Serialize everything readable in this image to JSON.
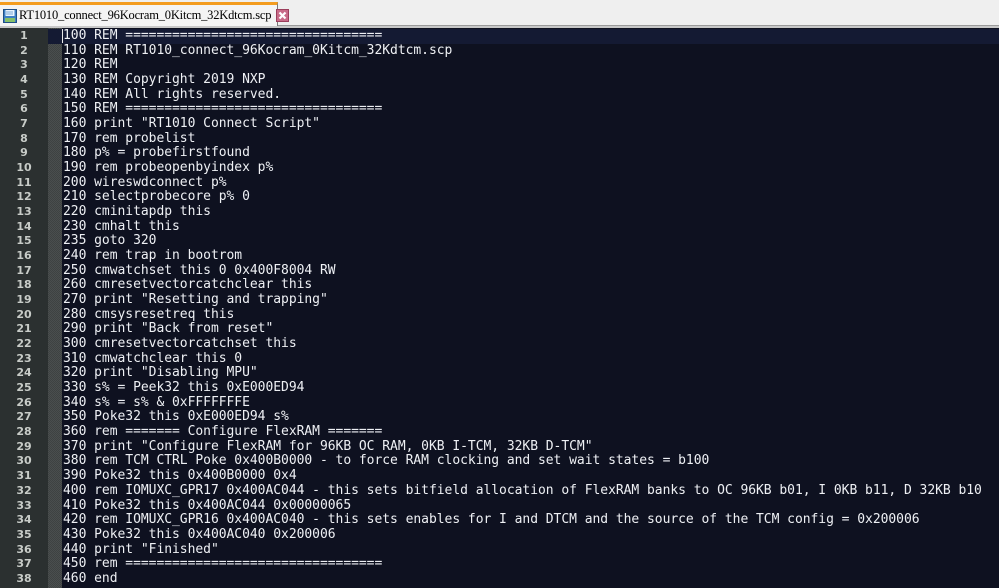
{
  "tab": {
    "title": "RT1010_connect_96Kocram_0Kitcm_32Kdtcm.scp",
    "icon": "save-icon",
    "close_icon": "close-icon"
  },
  "editor": {
    "current_line": 1,
    "lines": [
      {
        "num": "1",
        "text": "100 REM ================================="
      },
      {
        "num": "2",
        "text": "110 REM RT1010_connect_96Kocram_0Kitcm_32Kdtcm.scp"
      },
      {
        "num": "3",
        "text": "120 REM"
      },
      {
        "num": "4",
        "text": "130 REM Copyright 2019 NXP"
      },
      {
        "num": "5",
        "text": "140 REM All rights reserved."
      },
      {
        "num": "6",
        "text": "150 REM ================================="
      },
      {
        "num": "7",
        "text": "160 print \"RT1010 Connect Script\""
      },
      {
        "num": "8",
        "text": "170 rem probelist"
      },
      {
        "num": "9",
        "text": "180 p% = probefirstfound"
      },
      {
        "num": "10",
        "text": "190 rem probeopenbyindex p%"
      },
      {
        "num": "11",
        "text": "200 wireswdconnect p%"
      },
      {
        "num": "12",
        "text": "210 selectprobecore p% 0"
      },
      {
        "num": "13",
        "text": "220 cminitapdp this"
      },
      {
        "num": "14",
        "text": "230 cmhalt this"
      },
      {
        "num": "15",
        "text": "235 goto 320"
      },
      {
        "num": "16",
        "text": "240 rem trap in bootrom"
      },
      {
        "num": "17",
        "text": "250 cmwatchset this 0 0x400F8004 RW"
      },
      {
        "num": "18",
        "text": "260 cmresetvectorcatchclear this"
      },
      {
        "num": "19",
        "text": "270 print \"Resetting and trapping\""
      },
      {
        "num": "20",
        "text": "280 cmsysresetreq this"
      },
      {
        "num": "21",
        "text": "290 print \"Back from reset\""
      },
      {
        "num": "22",
        "text": "300 cmresetvectorcatchset this"
      },
      {
        "num": "23",
        "text": "310 cmwatchclear this 0"
      },
      {
        "num": "24",
        "text": "320 print \"Disabling MPU\""
      },
      {
        "num": "25",
        "text": "330 s% = Peek32 this 0xE000ED94"
      },
      {
        "num": "26",
        "text": "340 s% = s% & 0xFFFFFFFE"
      },
      {
        "num": "27",
        "text": "350 Poke32 this 0xE000ED94 s%"
      },
      {
        "num": "28",
        "text": "360 rem ======= Configure FlexRAM ======="
      },
      {
        "num": "29",
        "text": "370 print \"Configure FlexRAM for 96KB OC RAM, 0KB I-TCM, 32KB D-TCM\""
      },
      {
        "num": "30",
        "text": "380 rem TCM CTRL Poke 0x400B0000 - to force RAM clocking and set wait states = b100"
      },
      {
        "num": "31",
        "text": "390 Poke32 this 0x400B0000 0x4"
      },
      {
        "num": "32",
        "text": "400 rem IOMUXC_GPR17 0x400AC044 - this sets bitfield allocation of FlexRAM banks to OC 96KB b01, I 0KB b11, D 32KB b10"
      },
      {
        "num": "33",
        "text": "410 Poke32 this 0x400AC044 0x00000065"
      },
      {
        "num": "34",
        "text": "420 rem IOMUXC_GPR16 0x400AC040 - this sets enables for I and DTCM and the source of the TCM config = 0x200006"
      },
      {
        "num": "35",
        "text": "430 Poke32 this 0x400AC040 0x200006"
      },
      {
        "num": "36",
        "text": "440 print \"Finished\""
      },
      {
        "num": "37",
        "text": "450 rem ================================="
      },
      {
        "num": "38",
        "text": "460 end"
      }
    ]
  }
}
